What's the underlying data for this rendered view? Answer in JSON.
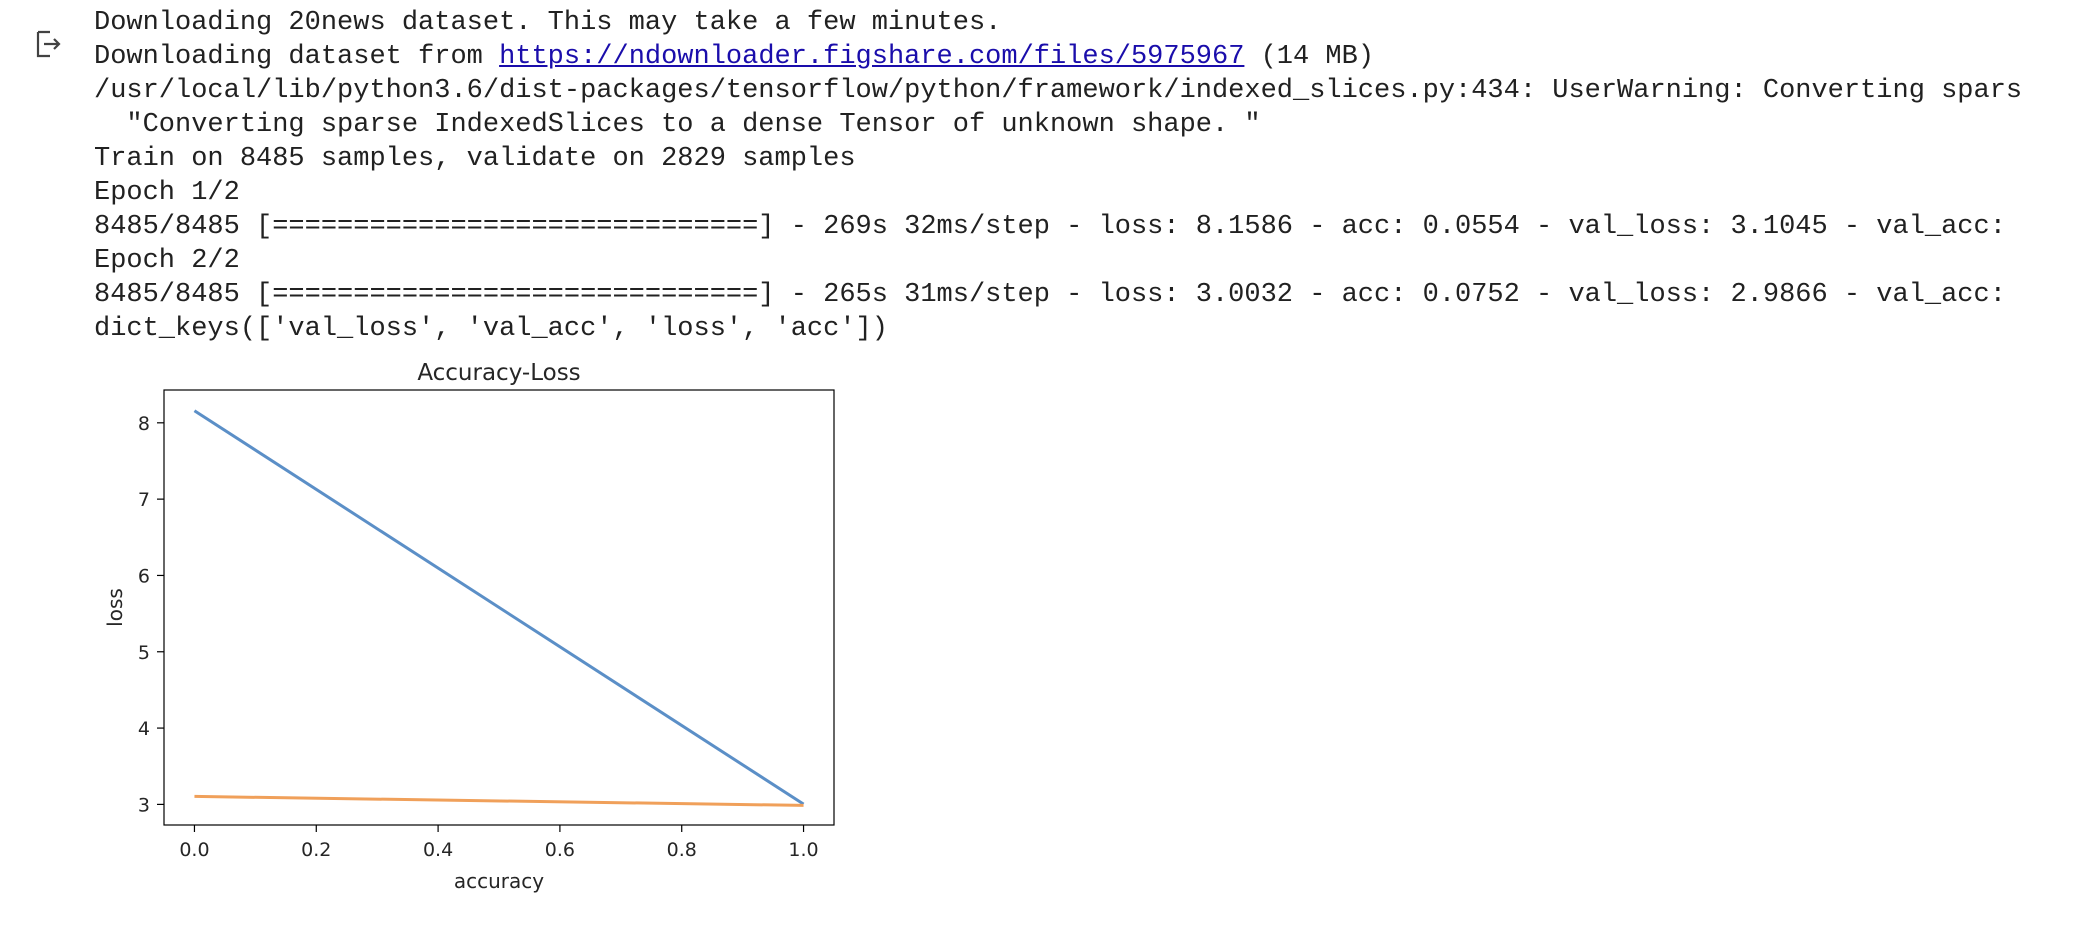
{
  "output": {
    "line1": "Downloading 20news dataset. This may take a few minutes.",
    "line2_prefix": "Downloading dataset from ",
    "line2_link": "https://ndownloader.figshare.com/files/5975967",
    "line2_suffix": " (14 MB)",
    "line3": "/usr/local/lib/python3.6/dist-packages/tensorflow/python/framework/indexed_slices.py:434: UserWarning: Converting spars",
    "line4": "  \"Converting sparse IndexedSlices to a dense Tensor of unknown shape. \"",
    "line5": "Train on 8485 samples, validate on 2829 samples",
    "line6": "Epoch 1/2",
    "line7": "8485/8485 [==============================] - 269s 32ms/step - loss: 8.1586 - acc: 0.0554 - val_loss: 3.1045 - val_acc:",
    "line8": "Epoch 2/2",
    "line9": "8485/8485 [==============================] - 265s 31ms/step - loss: 3.0032 - acc: 0.0752 - val_loss: 2.9866 - val_acc:",
    "line10": "dict_keys(['val_loss', 'val_acc', 'loss', 'acc'])"
  },
  "icons": {
    "output": "output-arrow-icon"
  },
  "colors": {
    "series1": "#5b8fc7",
    "series2": "#f0a05a",
    "link": "#1a0dab",
    "text": "#212121"
  },
  "chart_data": {
    "type": "line",
    "title": "Accuracy-Loss",
    "xlabel": "accuracy",
    "ylabel": "loss",
    "x": [
      0.0,
      1.0
    ],
    "series": [
      {
        "values": [
          8.1586,
          3.0032
        ]
      },
      {
        "values": [
          3.1045,
          2.9866
        ]
      }
    ],
    "xlim": [
      -0.05,
      1.05
    ],
    "ylim": [
      2.73,
      8.43
    ],
    "xticks": [
      "0.0",
      "0.2",
      "0.4",
      "0.6",
      "0.8",
      "1.0"
    ],
    "yticks": [
      "3",
      "4",
      "5",
      "6",
      "7",
      "8"
    ],
    "grid": false
  }
}
